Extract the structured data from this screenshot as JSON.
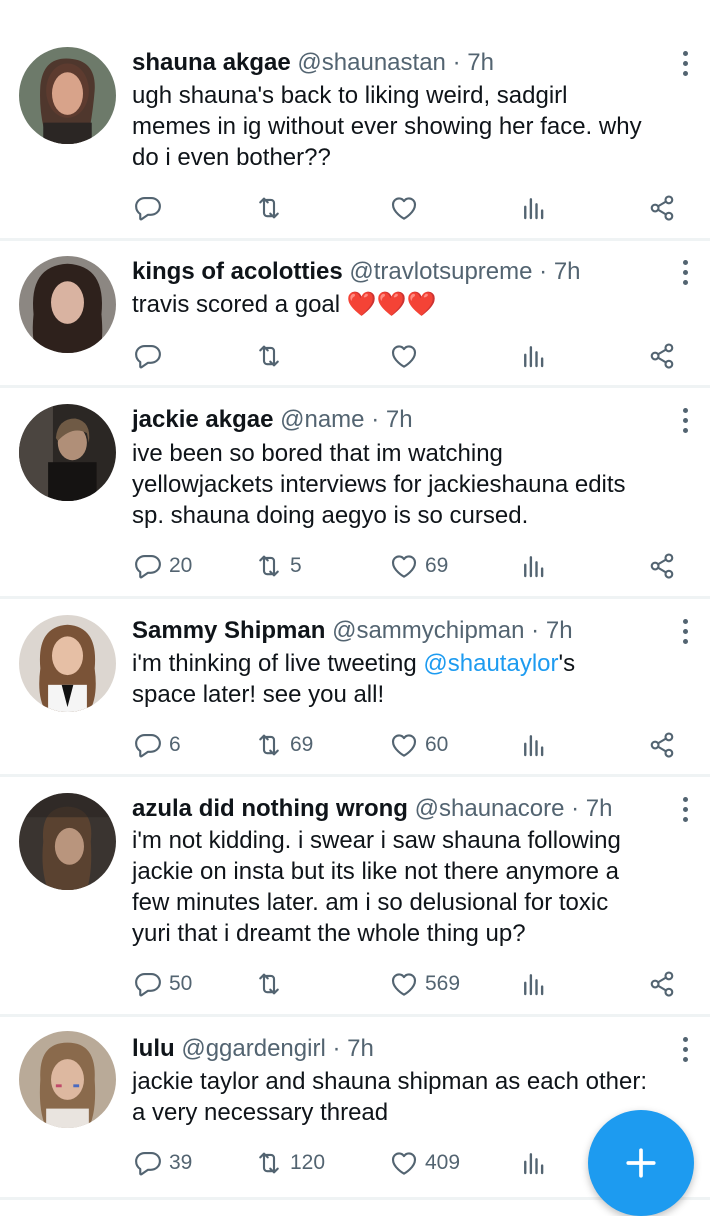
{
  "tweets": [
    {
      "name": "shauna akgae",
      "handle": "@shaunastan",
      "time": "7h",
      "text_lines": [
        "ugh shauna's back to liking weird, sadgirl",
        "memes in ig without ever showing her face. why",
        "do i even bother??"
      ],
      "reply_count": "",
      "retweet_count": "",
      "like_count": ""
    },
    {
      "name": "kings of acolotties",
      "handle": "@travlotsupreme",
      "time": "7h",
      "text_lines": [
        "travis scored a goal ❤️❤️❤️"
      ],
      "reply_count": "",
      "retweet_count": "",
      "like_count": ""
    },
    {
      "name": "jackie akgae",
      "handle": "@name",
      "time": "7h",
      "text_lines": [
        "ive been so bored that im watching",
        "yellowjackets interviews for jackieshauna edits",
        "sp. shauna doing aegyo is so cursed."
      ],
      "reply_count": "20",
      "retweet_count": "5",
      "like_count": "69"
    },
    {
      "name": "Sammy Shipman",
      "handle": "@sammychipman",
      "time": "7h",
      "text_pre": "i'm thinking of live tweeting ",
      "mention": "@shautaylor",
      "text_post": "'s",
      "text_line2": "space later! see you all!",
      "reply_count": "6",
      "retweet_count": "69",
      "like_count": "60"
    },
    {
      "name": "azula did nothing wrong",
      "handle": "@shaunacore",
      "time": "7h",
      "text_lines": [
        "i'm not kidding. i swear i saw shauna following",
        "jackie on insta but its like not there anymore a",
        "few minutes later. am i so delusional for toxic",
        "yuri that i dreamt the whole thing up?"
      ],
      "reply_count": "50",
      "retweet_count": "",
      "like_count": "569"
    },
    {
      "name": "lulu",
      "handle": "@ggardengirl",
      "time": "7h",
      "text_lines": [
        "jackie taylor and shauna shipman as each other:",
        "a very necessary thread"
      ],
      "reply_count": "39",
      "retweet_count": "120",
      "like_count": "409"
    }
  ],
  "separator": "·",
  "icons": {
    "reply": "reply-icon",
    "retweet": "retweet-icon",
    "like": "heart-icon",
    "views": "views-icon",
    "share": "share-icon",
    "more": "more-dots-icon",
    "compose": "plus-icon"
  },
  "colors": {
    "accent": "#1d9bf0",
    "muted": "#536471",
    "text": "#0f1419",
    "divider": "#eff3f4"
  }
}
